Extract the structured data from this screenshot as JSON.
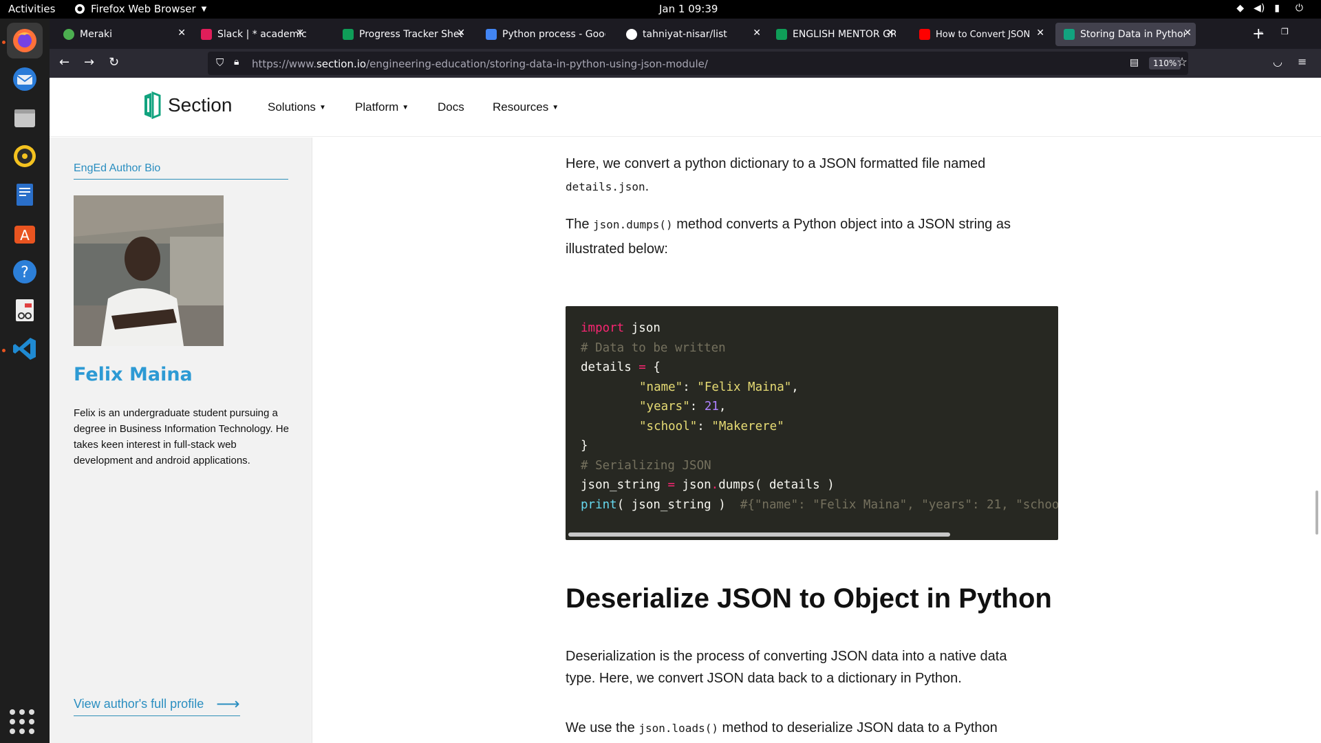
{
  "topbar": {
    "activities": "Activities",
    "app_name": "Firefox Web Browser",
    "clock": "Jan 1  09:39"
  },
  "tabs": [
    {
      "label": "Meraki",
      "color": "#4caf50"
    },
    {
      "label": "Slack | * academics | N",
      "color": "#e01e5a"
    },
    {
      "label": "Progress Tracker Shee",
      "color": "#0f9d58"
    },
    {
      "label": "Python process - Goog",
      "color": "#4285f4"
    },
    {
      "label": "tahniyat-nisar/list",
      "color": "#ffffff"
    },
    {
      "label": "ENGLISH MENTOR GR",
      "color": "#0f9d58"
    },
    {
      "label": "How to Convert JSON",
      "color": "#ff0000"
    },
    {
      "label": "Storing Data in Python",
      "color": "#12a37f"
    }
  ],
  "urlbar": {
    "url_prefix": "https://www.",
    "url_domain": "section.io",
    "url_path": "/engineering-education/storing-data-in-python-using-json-module/",
    "zoom": "110%"
  },
  "site": {
    "logo_text": "Section",
    "brand_color": "#12a37f",
    "menu": [
      "Solutions",
      "Platform",
      "Docs",
      "Resources"
    ]
  },
  "sidebar": {
    "heading": "EngEd Author Bio",
    "author_name": "Felix Maina",
    "author_desc": "Felix is an undergraduate student pursuing a degree in Business Information Technology. He takes keen interest in full-stack web development and android applications.",
    "profile_link": "View author's full profile"
  },
  "article": {
    "p1_a": "Here, we convert a python dictionary to a JSON formatted file named",
    "p1_code": "details.json",
    "p1_b": ".",
    "p2_a": "The",
    "p2_code": "json.dumps()",
    "p2_b": "method converts a Python object into a JSON string as",
    "p2_c": "illustrated below:",
    "code": {
      "l1_kw": "import",
      "l1_rest": " json",
      "l2": "# Data to be written",
      "l3_a": "details",
      "l3_op": " = ",
      "l3_b": "{",
      "l4_key": "\"name\"",
      "l4_val": "\"Felix Maina\"",
      "l5_key": "\"years\"",
      "l5_val": "21",
      "l6_key": "\"school\"",
      "l6_val": "\"Makerere\"",
      "l7": "}",
      "l8": "# Serializing JSON",
      "l9_a": "json_string",
      "l9_op": " = ",
      "l9_b": "json",
      "l9_dot": ".",
      "l9_c": "dumps( details )",
      "l10_fn": "print",
      "l10_a": "( json_string )  ",
      "l10_cm": "#{\"name\": \"Felix Maina\", \"years\": 21, \"schoo"
    },
    "h2": "Deserialize JSON to Object in Python",
    "p3_a": "Deserialization is the process of converting JSON data into a native data",
    "p3_b": "type. Here, we convert JSON data back to a dictionary in Python.",
    "p4_a": "We use the",
    "p4_code": "json.loads()",
    "p4_b": "method to deserialize JSON data to a Python"
  }
}
